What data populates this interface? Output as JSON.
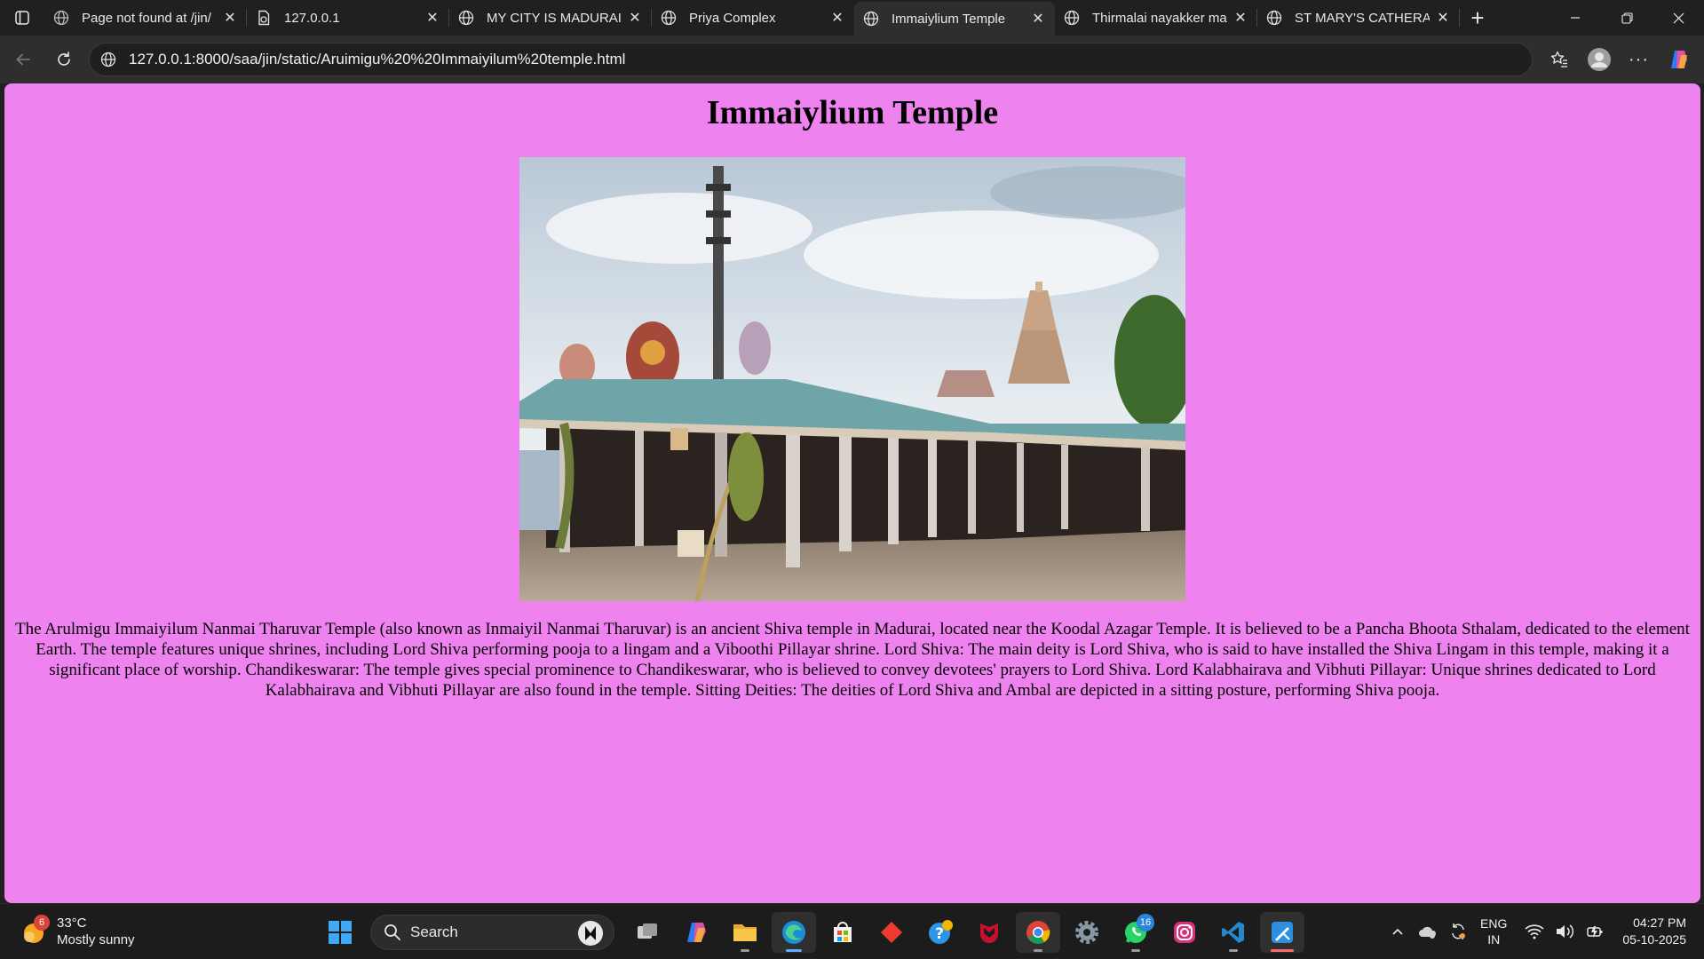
{
  "browser": {
    "tabs": [
      {
        "title": "Page not found at /jin/",
        "icon": "globe-icon",
        "active": false
      },
      {
        "title": "127.0.0.1",
        "icon": "file-icon",
        "active": false
      },
      {
        "title": "MY CITY IS MADURAI",
        "icon": "globe-icon",
        "active": false
      },
      {
        "title": "Priya Complex",
        "icon": "globe-icon",
        "active": false
      },
      {
        "title": "Immaiylium Temple",
        "icon": "globe-icon",
        "active": true
      },
      {
        "title": "Thirmalai nayakker ma",
        "icon": "globe-icon",
        "active": false
      },
      {
        "title": "ST MARY'S CATHERAL",
        "icon": "globe-icon",
        "active": false
      }
    ],
    "url": "127.0.0.1:8000/saa/jin/static/Aruimigu%20%20Immaiyilum%20temple.html"
  },
  "page": {
    "heading": "Immaiylium Temple",
    "image_description_icon": "temple-photo",
    "paragraph": "The Arulmigu Immaiyilum Nanmai Tharuvar Temple (also known as Inmaiyil Nanmai Tharuvar) is an ancient Shiva temple in Madurai, located near the Koodal Azagar Temple. It is believed to be a Pancha Bhoota Sthalam, dedicated to the element Earth. The temple features unique shrines, including Lord Shiva performing pooja to a lingam and a Viboothi Pillayar shrine. Lord Shiva: The main deity is Lord Shiva, who is said to have installed the Shiva Lingam in this temple, making it a significant place of worship. Chandikeswarar: The temple gives special prominence to Chandikeswarar, who is believed to convey devotees' prayers to Lord Shiva. Lord Kalabhairava and Vibhuti Pillayar: Unique shrines dedicated to Lord Kalabhairava and Vibhuti Pillayar are also found in the temple. Sitting Deities: The deities of Lord Shiva and Ambal are depicted in a sitting posture, performing Shiva pooja.",
    "background_color": "#ee82ee"
  },
  "taskbar": {
    "weather": {
      "temp": "33°C",
      "condition": "Mostly sunny",
      "badge": "6"
    },
    "search_label": "Search",
    "whatsapp_badge": "16",
    "lang_line1": "ENG",
    "lang_line2": "IN",
    "time": "04:27 PM",
    "date": "05-10-2025"
  }
}
